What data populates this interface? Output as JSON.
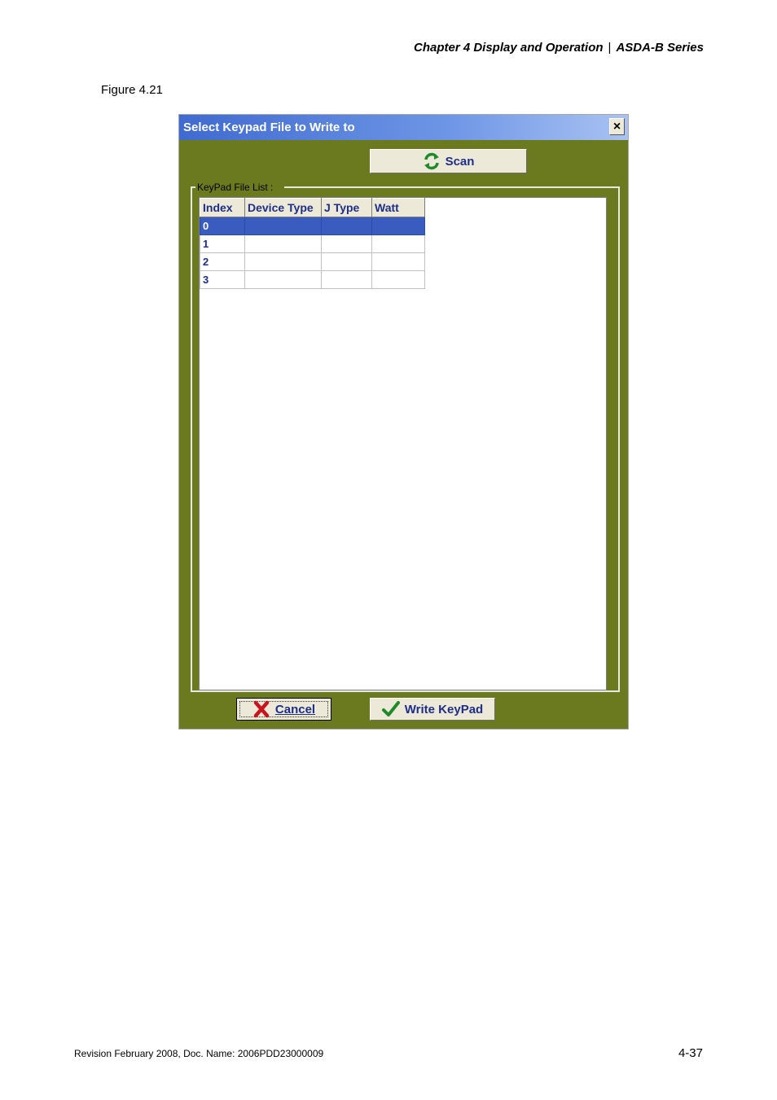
{
  "header": {
    "chapter": "Chapter 4  Display and Operation",
    "separator": "|",
    "series": "ASDA-B Series"
  },
  "figure_label": "Figure 4.21",
  "dialog": {
    "title": "Select Keypad File to Write to",
    "close_label": "×",
    "scan_label": "Scan",
    "group_label": "KeyPad File List :",
    "columns": [
      "Index",
      "Device Type",
      "J Type",
      "Watt"
    ],
    "rows": [
      {
        "index": "0",
        "device_type": "",
        "j_type": "",
        "watt": "",
        "selected": true
      },
      {
        "index": "1",
        "device_type": "",
        "j_type": "",
        "watt": "",
        "selected": false
      },
      {
        "index": "2",
        "device_type": "",
        "j_type": "",
        "watt": "",
        "selected": false
      },
      {
        "index": "3",
        "device_type": "",
        "j_type": "",
        "watt": "",
        "selected": false
      }
    ],
    "cancel_label": "Cancel",
    "write_label": "Write KeyPad"
  },
  "footer": {
    "revision": "Revision February 2008, Doc. Name: 2006PDD23000009",
    "page_number": "4-37"
  },
  "colors": {
    "dialog_bg": "#6b7a1f",
    "titlebar": "#3f6ad0",
    "selected_row": "#3a5bbf",
    "button_text": "#1e2e88"
  }
}
